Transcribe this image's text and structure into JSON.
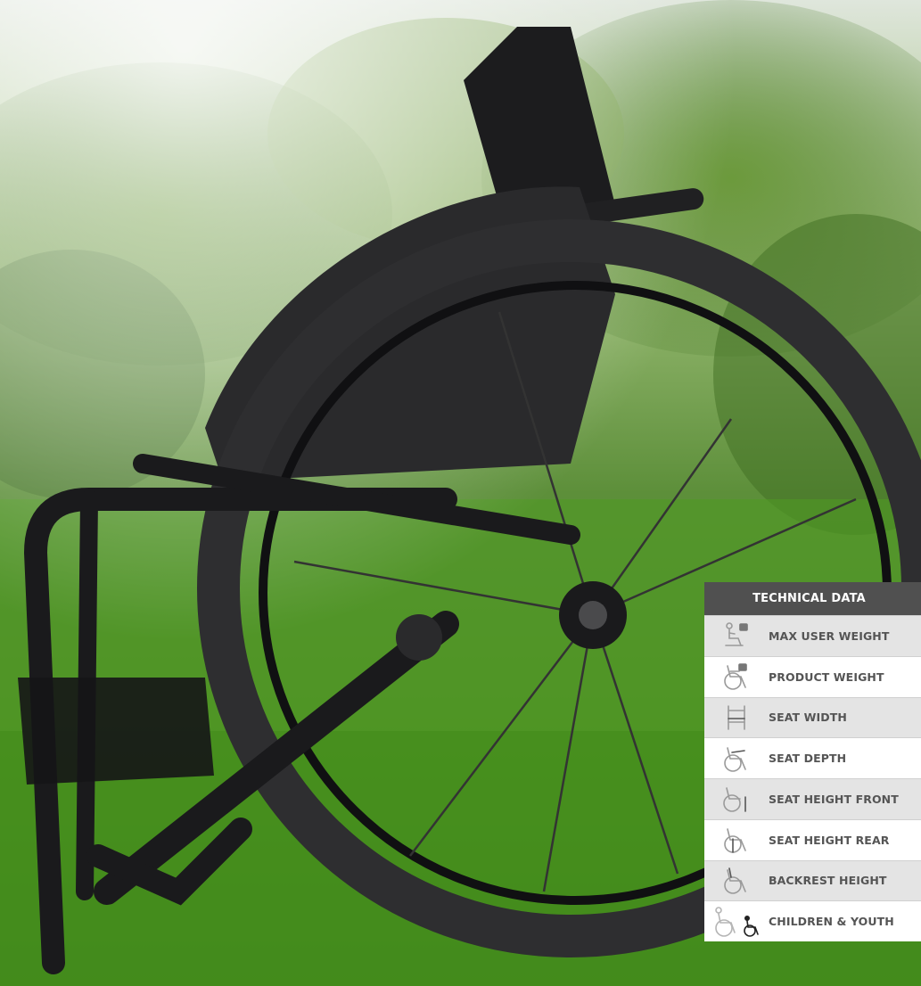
{
  "technical_data": {
    "header": "TECHNICAL DATA",
    "rows": [
      {
        "label": "MAX USER WEIGHT",
        "icon": "user-weight-icon"
      },
      {
        "label": "PRODUCT WEIGHT",
        "icon": "product-weight-icon"
      },
      {
        "label": "SEAT WIDTH",
        "icon": "seat-width-icon"
      },
      {
        "label": "SEAT DEPTH",
        "icon": "seat-depth-icon"
      },
      {
        "label": "SEAT HEIGHT FRONT",
        "icon": "seat-height-front-icon"
      },
      {
        "label": "SEAT HEIGHT REAR",
        "icon": "seat-height-rear-icon"
      },
      {
        "label": "BACKREST HEIGHT",
        "icon": "backrest-height-icon"
      },
      {
        "label": "CHILDREN & YOUTH",
        "icon": "children-youth-icon"
      }
    ]
  },
  "colors": {
    "header_bg": "#505050",
    "row_shade": "#e4e4e4",
    "row_light": "#ffffff",
    "label_text": "#555555",
    "icon_stroke": "#9a9a9a"
  }
}
